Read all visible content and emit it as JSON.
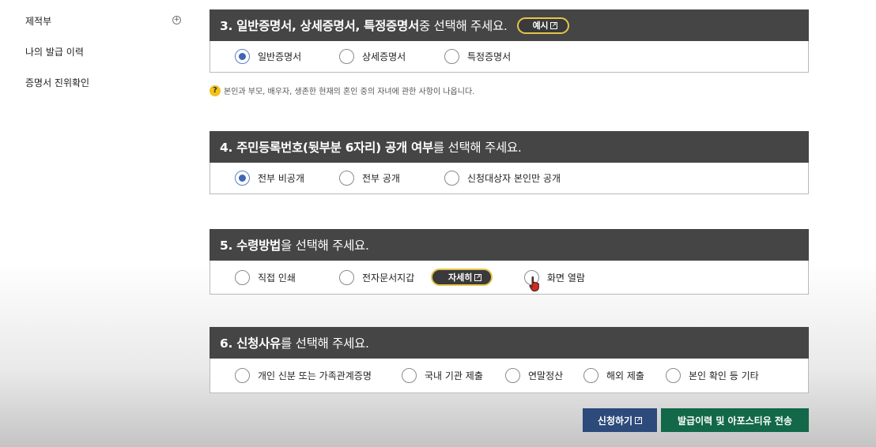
{
  "sidebar": {
    "items": [
      {
        "label": "제적부"
      },
      {
        "label": "나의 발급 이력"
      },
      {
        "label": "증명서 진위확인"
      }
    ],
    "expand_symbol": "+"
  },
  "sections": {
    "s3": {
      "title_bold": "3. 일반증명서, 상세증명서, 특정증명서",
      "title_rest": " 중 선택해 주세요.",
      "example_label": "예시",
      "options": [
        "일반증명서",
        "상세증명서",
        "특정증명서"
      ],
      "selected_index": 0,
      "note_icon": "?",
      "note": "본인과 부모, 배우자, 생존한 현재의 혼인 중의 자녀에 관한 사항이 나옵니다."
    },
    "s4": {
      "title_bold": "4. 주민등록번호(뒷부분 6자리) 공개 여부",
      "title_rest": "를 선택해 주세요.",
      "options": [
        "전부 비공개",
        "전부 공개",
        "신청대상자 본인만 공개"
      ],
      "selected_index": 0
    },
    "s5": {
      "title_bold": "5. 수령방법",
      "title_rest": "을 선택해 주세요.",
      "options": [
        "직접 인쇄",
        "전자문서지갑",
        "화면 열람"
      ],
      "detail_label": "자세히",
      "selected_index": -1
    },
    "s6": {
      "title_bold": "6. 신청사유",
      "title_rest": "를 선택해 주세요.",
      "options": [
        "개인 신분 또는 가족관계증명",
        "국내 기관 제출",
        "연말정산",
        "해외 제출",
        "본인 확인 등 기타"
      ],
      "selected_index": -1
    }
  },
  "buttons": {
    "apply": "신청하기",
    "send": "발급이력 및 아포스티유 전송"
  },
  "colors": {
    "header_bg": "#454545",
    "accent_gold": "#e6c44a",
    "radio_checked": "#3f65b5",
    "apply_bg": "#2c4a7a",
    "send_bg": "#126849"
  },
  "icons": {
    "external_link": "external-link-icon",
    "help": "question-circle-icon",
    "cursor": "hand-cursor-icon"
  }
}
